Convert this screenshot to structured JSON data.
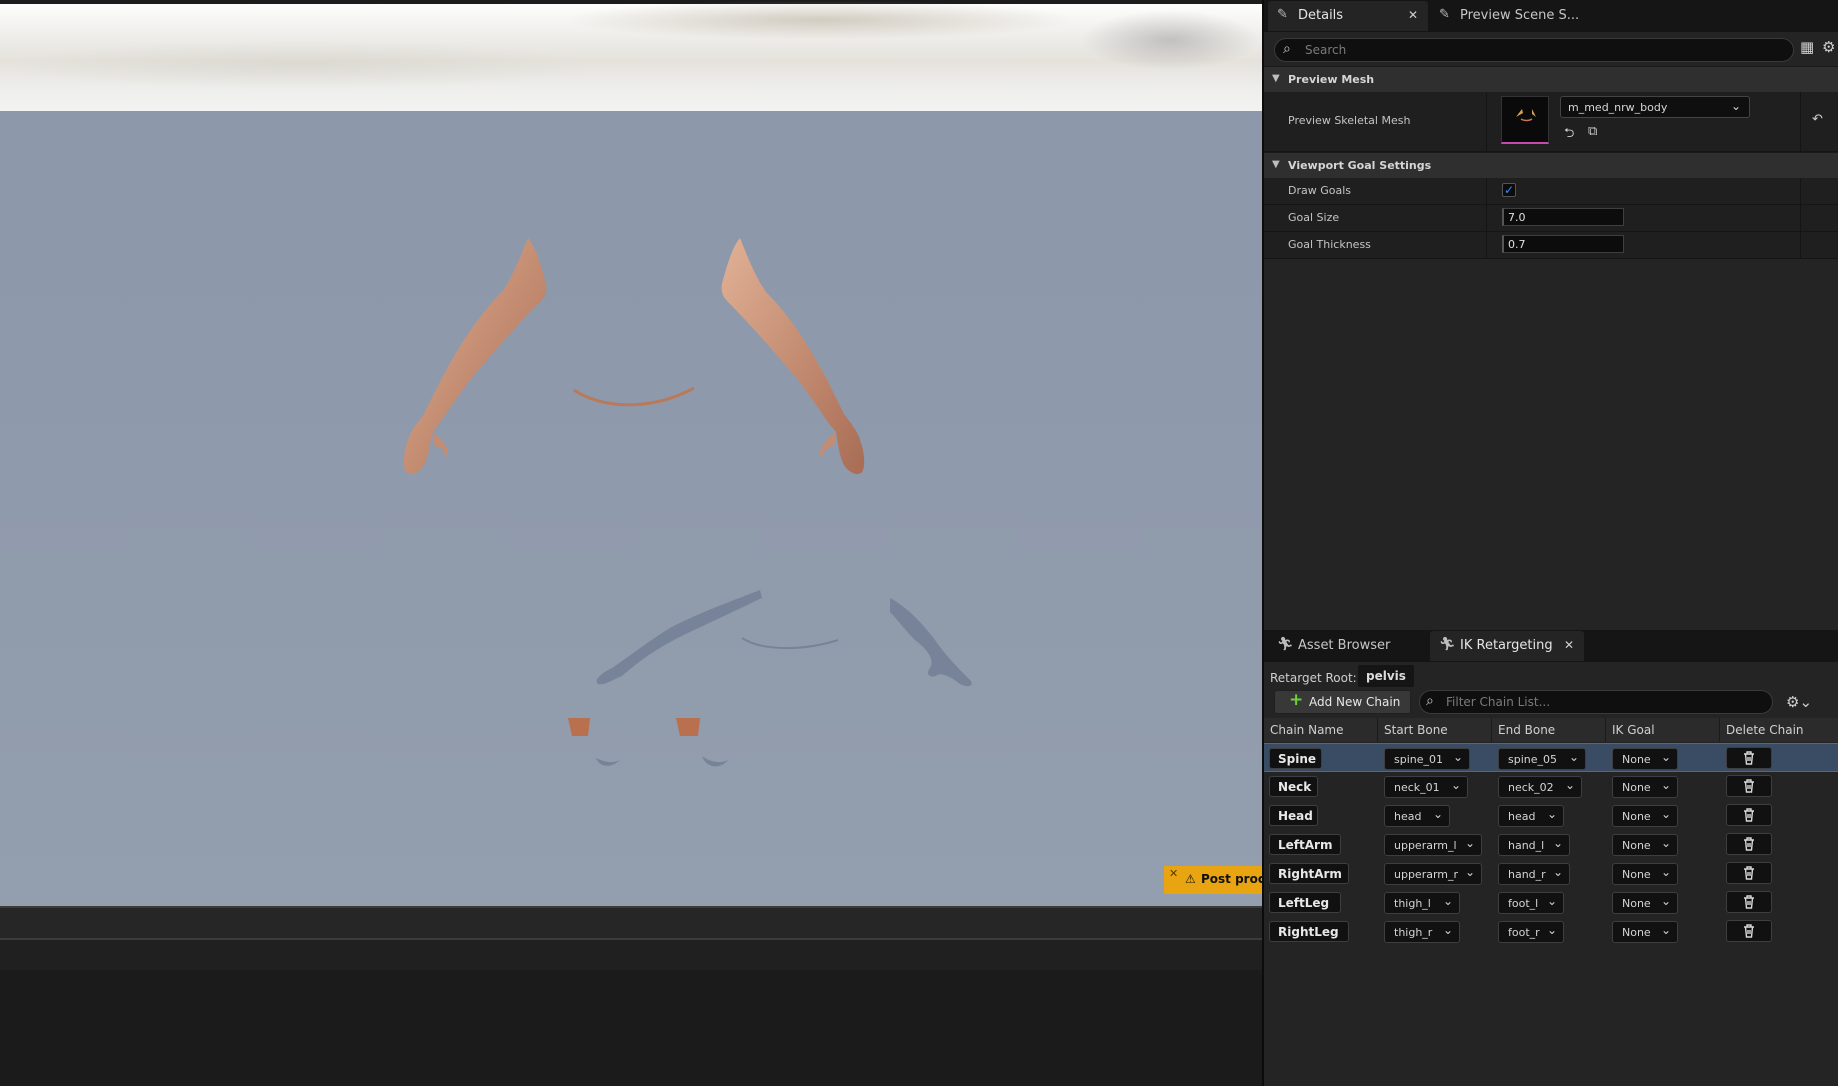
{
  "viewport": {
    "warning_text": "Post proc"
  },
  "details_tabs": [
    {
      "label": "Details"
    },
    {
      "label": "Preview Scene S..."
    }
  ],
  "search": {
    "placeholder": "Search"
  },
  "sections": {
    "preview_mesh": {
      "title": "Preview Mesh",
      "preview_skeletal_mesh_label": "Preview Skeletal Mesh",
      "preview_skeletal_mesh_value": "m_med_nrw_body"
    },
    "viewport_goal_settings": {
      "title": "Viewport Goal Settings",
      "draw_goals_label": "Draw Goals",
      "draw_goals_checked": true,
      "goal_size_label": "Goal Size",
      "goal_size_value": "7.0",
      "goal_thickness_label": "Goal Thickness",
      "goal_thickness_value": "0.7"
    }
  },
  "bottom_tabs": [
    {
      "label": "Asset Browser"
    },
    {
      "label": "IK Retargeting"
    }
  ],
  "ik": {
    "retarget_root_label": "Retarget Root:",
    "retarget_root_value": "pelvis",
    "add_chain_label": "Add New Chain",
    "filter_placeholder": "Filter Chain List...",
    "columns": [
      "Chain Name",
      "Start Bone",
      "End Bone",
      "IK Goal",
      "Delete Chain"
    ],
    "chains": [
      {
        "name": "Spine",
        "start": "spine_01",
        "end": "spine_05",
        "goal": "None"
      },
      {
        "name": "Neck",
        "start": "neck_01",
        "end": "neck_02",
        "goal": "None"
      },
      {
        "name": "Head",
        "start": "head",
        "end": "head",
        "goal": "None"
      },
      {
        "name": "LeftArm",
        "start": "upperarm_l",
        "end": "hand_l",
        "goal": "None"
      },
      {
        "name": "RightArm",
        "start": "upperarm_r",
        "end": "hand_r",
        "goal": "None"
      },
      {
        "name": "LeftLeg",
        "start": "thigh_l",
        "end": "foot_l",
        "goal": "None"
      },
      {
        "name": "RightLeg",
        "start": "thigh_r",
        "end": "foot_r",
        "goal": "None"
      }
    ]
  },
  "colors": {
    "accent_blue": "#3a8bff",
    "warning_yellow": "#e8a511",
    "add_green": "#6fcf3a",
    "selected_row": "#3a4b64"
  },
  "icons": [
    "search-icon",
    "gear-icon",
    "table-view-icon",
    "close-icon",
    "chevron-down-icon",
    "trash-icon",
    "plus-icon",
    "warning-icon",
    "pencil-icon",
    "running-figure-icon",
    "reset-icon",
    "browse-icon",
    "use-selected-icon"
  ]
}
